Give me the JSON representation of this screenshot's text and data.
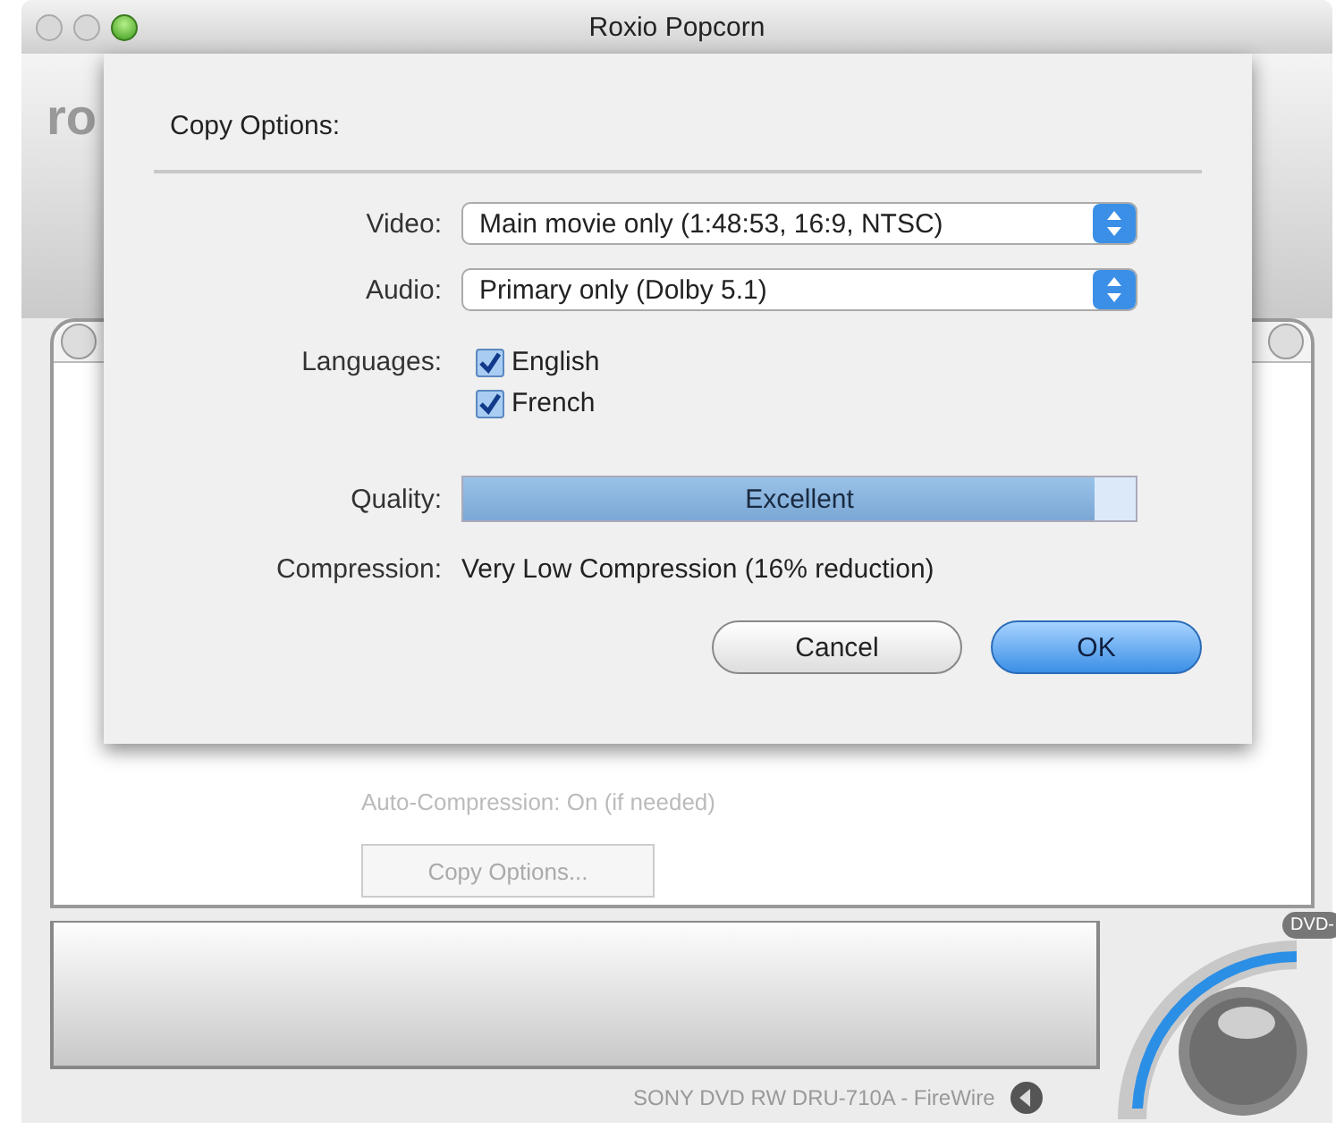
{
  "window": {
    "title": "Roxio Popcorn",
    "logo_fragment": "ro"
  },
  "sheet": {
    "title": "Copy Options:",
    "video": {
      "label": "Video:",
      "value": "Main movie only (1:48:53, 16:9, NTSC)"
    },
    "audio": {
      "label": "Audio:",
      "value": "Primary only (Dolby 5.1)"
    },
    "languages": {
      "label": "Languages:",
      "options": [
        {
          "label": "English",
          "checked": true
        },
        {
          "label": "French",
          "checked": true
        }
      ]
    },
    "quality": {
      "label": "Quality:",
      "value": "Excellent",
      "level": 0.94
    },
    "compression": {
      "label": "Compression:",
      "value": "Very Low Compression (16% reduction)"
    },
    "buttons": [
      {
        "label": "Cancel",
        "kind": "secondary"
      },
      {
        "label": "OK",
        "kind": "default"
      }
    ]
  },
  "background": {
    "auto_compression": "Auto-Compression: On (if needed)",
    "copy_options_button": "Copy Options...",
    "device": "SONY DVD RW DRU-710A - FireWire",
    "disc_badge": "DVD-"
  }
}
